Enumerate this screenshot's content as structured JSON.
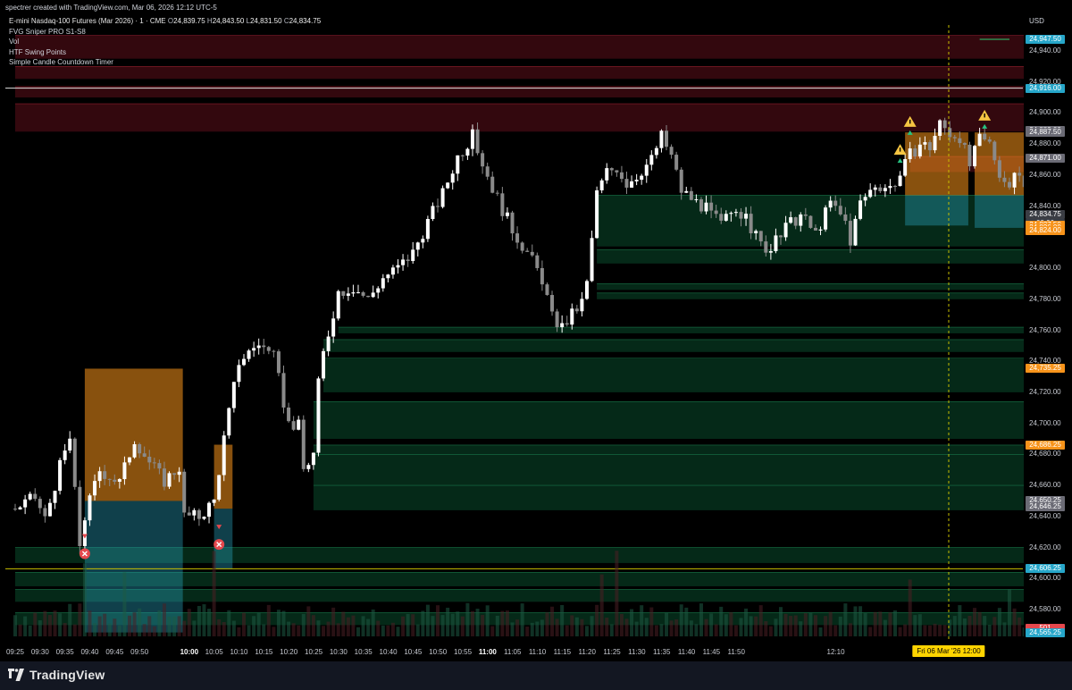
{
  "header": {
    "credit": "spectrer created with TradingView.com, Mar 06, 2026 12:12 UTC-5"
  },
  "legend": {
    "symbol": "E-mini Nasdaq-100 Futures (Mar 2026) · 1 · CME",
    "open_label": "O",
    "open": "24,839.75",
    "high_label": "H",
    "high": "24,843.50",
    "low_label": "L",
    "low": "24,831.50",
    "close_label": "C",
    "close": "24,834.75",
    "indicators": [
      "FVG Sniper PRO S1-S8",
      "Vol",
      "HTF Swing Points",
      "Simple Candle Countdown Timer"
    ]
  },
  "axis": {
    "currency": "USD",
    "y_ticks": [
      "24,940.00",
      "24,920.00",
      "24,900.00",
      "24,880.00",
      "24,860.00",
      "24,840.00",
      "24,800.00",
      "24,780.00",
      "24,760.00",
      "24,740.00",
      "24,720.00",
      "24,700.00",
      "24,680.00",
      "24,660.00",
      "24,640.00",
      "24,620.00",
      "24,600.00",
      "24,580.00"
    ],
    "price_tags": [
      {
        "label": "24,947.50",
        "color": "#26a6c9"
      },
      {
        "label": "24,916.00",
        "color": "#26a6c9"
      },
      {
        "label": "24,889.00",
        "color": "#6b6b75"
      },
      {
        "label": "24,887.50",
        "color": "#6b6b75"
      },
      {
        "label": "24,871.00",
        "color": "#6b6b75"
      },
      {
        "label": "24,834.75",
        "color": "#3a3d44"
      },
      {
        "label": "00:06",
        "color": "#3a3d44"
      },
      {
        "label": "24,827.50",
        "color": "#f7931a"
      },
      {
        "label": "24,826.00",
        "color": "#f7931a"
      },
      {
        "label": "24,824.00",
        "color": "#f7931a"
      },
      {
        "label": "24,735.25",
        "color": "#f7931a"
      },
      {
        "label": "24,686.25",
        "color": "#f7931a"
      },
      {
        "label": "24,650.25",
        "color": "#6b6b75"
      },
      {
        "label": "24,646.25",
        "color": "#6b6b75"
      },
      {
        "label": "24,606.25",
        "color": "#26a6c9"
      },
      {
        "label": "501",
        "color": "#e5484d"
      },
      {
        "label": "24,565.25",
        "color": "#26a6c9"
      }
    ],
    "x_ticks": [
      {
        "label": "09:25",
        "bold": false
      },
      {
        "label": "09:30",
        "bold": false
      },
      {
        "label": "09:35",
        "bold": false
      },
      {
        "label": "09:40",
        "bold": false
      },
      {
        "label": "09:45",
        "bold": false
      },
      {
        "label": "09:50",
        "bold": false
      },
      {
        "label": "10:00",
        "bold": true
      },
      {
        "label": "10:05",
        "bold": false
      },
      {
        "label": "10:10",
        "bold": false
      },
      {
        "label": "10:15",
        "bold": false
      },
      {
        "label": "10:20",
        "bold": false
      },
      {
        "label": "10:25",
        "bold": false
      },
      {
        "label": "10:30",
        "bold": false
      },
      {
        "label": "10:35",
        "bold": false
      },
      {
        "label": "10:40",
        "bold": false
      },
      {
        "label": "10:45",
        "bold": false
      },
      {
        "label": "10:50",
        "bold": false
      },
      {
        "label": "10:55",
        "bold": false
      },
      {
        "label": "11:00",
        "bold": true
      },
      {
        "label": "11:05",
        "bold": false
      },
      {
        "label": "11:10",
        "bold": false
      },
      {
        "label": "11:15",
        "bold": false
      },
      {
        "label": "11:20",
        "bold": false
      },
      {
        "label": "11:25",
        "bold": false
      },
      {
        "label": "11:30",
        "bold": false
      },
      {
        "label": "11:35",
        "bold": false
      },
      {
        "label": "11:40",
        "bold": false
      },
      {
        "label": "11:45",
        "bold": false
      },
      {
        "label": "11:50",
        "bold": false
      },
      {
        "label": "12:10",
        "bold": false
      }
    ],
    "crosshair_date": "Fri 06 Mar '26  12:00"
  },
  "brand": {
    "name": "TradingView",
    "logo_icon": "tradingview-logo-icon"
  },
  "colors": {
    "bull": "#ffffff",
    "bear": "#8a8a8a",
    "fvg_bull": "#0b5a36",
    "fvg_bear": "#5c0f1a",
    "target": "#f7931a",
    "stop": "#2aa8c6"
  },
  "chart_data": {
    "type": "candlestick",
    "title": "E-mini Nasdaq-100 Futures (Mar 2026) · 1 · CME",
    "x_unit": "minute of session (09:25 to 12:12)",
    "ylim": [
      24560,
      24955
    ],
    "start_price": 24645,
    "path": [
      [
        0,
        24645
      ],
      [
        4,
        24652
      ],
      [
        6,
        24638
      ],
      [
        9,
        24672
      ],
      [
        11,
        24690
      ],
      [
        12,
        24655
      ],
      [
        13,
        24622
      ],
      [
        14,
        24640
      ],
      [
        17,
        24670
      ],
      [
        21,
        24662
      ],
      [
        24,
        24690
      ],
      [
        27,
        24675
      ],
      [
        30,
        24663
      ],
      [
        33,
        24672
      ],
      [
        34,
        24640
      ],
      [
        37,
        24640
      ],
      [
        40,
        24650
      ],
      [
        42,
        24690
      ],
      [
        45,
        24740
      ],
      [
        49,
        24752
      ],
      [
        52,
        24742
      ],
      [
        55,
        24700
      ],
      [
        57,
        24698
      ],
      [
        58,
        24670
      ],
      [
        60,
        24680
      ],
      [
        61,
        24725
      ],
      [
        62,
        24745
      ],
      [
        65,
        24785
      ],
      [
        68,
        24788
      ],
      [
        71,
        24780
      ],
      [
        74,
        24794
      ],
      [
        77,
        24800
      ],
      [
        80,
        24810
      ],
      [
        83,
        24830
      ],
      [
        86,
        24848
      ],
      [
        89,
        24872
      ],
      [
        92,
        24885
      ],
      [
        94,
        24868
      ],
      [
        96,
        24852
      ],
      [
        98,
        24838
      ],
      [
        100,
        24825
      ],
      [
        103,
        24810
      ],
      [
        106,
        24793
      ],
      [
        108,
        24768
      ],
      [
        110,
        24762
      ],
      [
        112,
        24770
      ],
      [
        114,
        24778
      ],
      [
        115,
        24790
      ],
      [
        117,
        24848
      ],
      [
        119,
        24862
      ],
      [
        121,
        24865
      ],
      [
        123,
        24855
      ],
      [
        125,
        24860
      ],
      [
        128,
        24870
      ],
      [
        130,
        24885
      ],
      [
        132,
        24872
      ],
      [
        134,
        24850
      ],
      [
        136,
        24845
      ],
      [
        139,
        24838
      ],
      [
        142,
        24828
      ],
      [
        145,
        24840
      ],
      [
        148,
        24826
      ],
      [
        150,
        24815
      ],
      [
        152,
        24812
      ],
      [
        155,
        24826
      ],
      [
        158,
        24834
      ],
      [
        161,
        24822
      ],
      [
        164,
        24842
      ],
      [
        167,
        24830
      ],
      [
        168,
        24818
      ],
      [
        170,
        24842
      ],
      [
        173,
        24854
      ],
      [
        176,
        24852
      ],
      [
        178,
        24860
      ],
      [
        180,
        24873
      ],
      [
        182,
        24880
      ],
      [
        184,
        24878
      ],
      [
        186,
        24893
      ],
      [
        188,
        24887
      ],
      [
        190,
        24885
      ],
      [
        192,
        24866
      ],
      [
        194,
        24883
      ],
      [
        196,
        24880
      ],
      [
        198,
        24862
      ],
      [
        200,
        24852
      ],
      [
        202,
        24862
      ],
      [
        204,
        24840
      ],
      [
        207,
        24832
      ]
    ],
    "volume_profile": "low flat volume with spikes at 09:35, 09:47, 10:00, 10:55, 11:00, 11:45",
    "fvg_bull_zones": [
      [
        24814,
        24847,
        117,
        217
      ],
      [
        24803,
        24812,
        117,
        217
      ],
      [
        24786,
        24790,
        117,
        217
      ],
      [
        24780,
        24784,
        117,
        217
      ],
      [
        24758,
        24762,
        65,
        217
      ],
      [
        24746,
        24754,
        62,
        217
      ],
      [
        24720,
        24742,
        62,
        217
      ],
      [
        24690,
        24714,
        60,
        217
      ],
      [
        24680,
        24686,
        60,
        217
      ],
      [
        24660,
        24680,
        60,
        217
      ],
      [
        24644,
        24660,
        60,
        217
      ],
      [
        24610,
        24620,
        0,
        217
      ],
      [
        24595,
        24604,
        0,
        217
      ],
      [
        24585,
        24593,
        0,
        217
      ],
      [
        24570,
        24578,
        0,
        217
      ]
    ],
    "fvg_bear_zones": [
      [
        24935,
        24950,
        0,
        217
      ],
      [
        24922,
        24930,
        0,
        217
      ],
      [
        24910,
        24917,
        0,
        217
      ],
      [
        24888,
        24906,
        0,
        217
      ],
      [
        24862,
        24872,
        180,
        217
      ]
    ],
    "trades": [
      {
        "entry": 24650,
        "target": 24735.25,
        "stop": 24565.25,
        "from": 14,
        "to": 33
      },
      {
        "entry": 24645,
        "target": 24686.25,
        "stop": 24606.25,
        "from": 40,
        "to": 43
      },
      {
        "entry": 24847,
        "target": 24887.5,
        "stop": 24827.5,
        "from": 179,
        "to": 191
      },
      {
        "entry": 24847,
        "target": 24887.5,
        "stop": 24826,
        "from": 193,
        "to": 204
      }
    ],
    "markers": [
      {
        "type": "stop-out",
        "minute": 14,
        "price": 24616
      },
      {
        "type": "stop-out",
        "minute": 41,
        "price": 24622
      },
      {
        "type": "warning",
        "minute": 178,
        "price": 24876
      },
      {
        "type": "warning",
        "minute": 180,
        "price": 24894
      },
      {
        "type": "warning",
        "minute": 195,
        "price": 24898
      }
    ],
    "lines": [
      {
        "price": 24916,
        "color": "#e0e0e0"
      },
      {
        "price": 24606.25,
        "color": "#c9c000"
      },
      {
        "price": 24947.5,
        "color": "#2ecc71",
        "from": 194,
        "to": 200
      }
    ]
  }
}
